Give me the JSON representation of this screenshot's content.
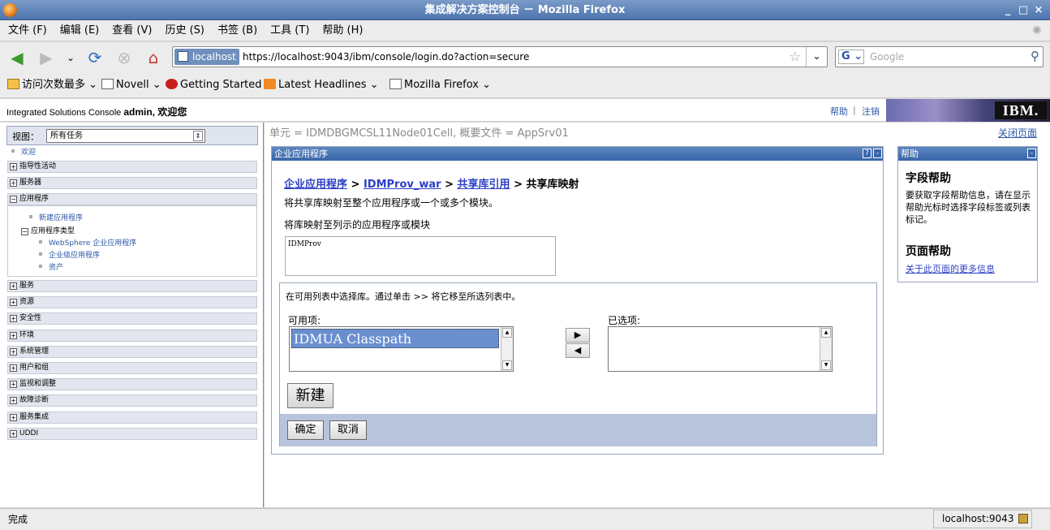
{
  "window": {
    "title": "集成解决方案控制台 － Mozilla Firefox",
    "controls": [
      "_",
      "□",
      "×"
    ]
  },
  "menu": [
    "文件 (F)",
    "编辑 (E)",
    "查看 (V)",
    "历史 (S)",
    "书签 (B)",
    "工具 (T)",
    "帮助 (H)"
  ],
  "nav": {
    "site_label": "localhost",
    "url": "https://localhost:9043/ibm/console/login.do?action=secure",
    "search_placeholder": "Google",
    "search_engine": "G"
  },
  "bookmarks": [
    {
      "label": "访问次数最多",
      "arrow": true,
      "icon": "most-visited-icon"
    },
    {
      "label": "Novell",
      "arrow": true,
      "icon": "folder-icon"
    },
    {
      "label": "Getting Started",
      "arrow": false,
      "icon": "firefox-red-icon"
    },
    {
      "label": "Latest Headlines",
      "arrow": true,
      "icon": "rss-icon"
    },
    {
      "label": "Mozilla Firefox",
      "arrow": true,
      "icon": "folder-icon"
    }
  ],
  "console": {
    "product": "Integrated Solutions Console",
    "user": "admin",
    "welcome": ", 欢迎您",
    "help": "帮助",
    "logout": "注销",
    "logo": "IBM."
  },
  "sidebar": {
    "view_label": "视图：",
    "view_value": "所有任务",
    "welcome": "欢迎",
    "items": [
      "指导性活动",
      "服务器",
      "应用程序",
      "服务",
      "资源",
      "安全性",
      "环境",
      "系统管理",
      "用户和组",
      "监视和调整",
      "故障诊断",
      "服务集成",
      "UDDI"
    ],
    "app_children": {
      "new_app": "新建应用程序",
      "app_types": "应用程序类型",
      "types": [
        "WebSphere 企业应用程序",
        "企业级应用程序",
        "资产"
      ]
    }
  },
  "main": {
    "cell_info": "单元 = IDMDBGMCSL11Node01Cell, 概要文件 = AppSrv01",
    "close_page": "关闭页面",
    "panel_title": "企业应用程序",
    "panel_buttons": [
      "?",
      "-"
    ],
    "breadcrumb": {
      "link1": "企业应用程序",
      "sep": " > ",
      "link2": "IDMProv_war",
      "link3": "共享库引用",
      "current": "共享库映射"
    },
    "description": "将共享库映射至整个应用程序或一个或多个模块。",
    "map_label": "将库映射至列示的应用程序或模块",
    "module": "IDMProv",
    "instruction": "在可用列表中选择库。通过单击 >> 将它移至所选列表中。",
    "available_label": "可用项:",
    "available_items": [
      "IDMUA Classpath"
    ],
    "selected_label": "已选项:",
    "move_right": "▶",
    "move_left": "◀",
    "new_button": "新建",
    "ok_button": "确定",
    "cancel_button": "取消"
  },
  "help": {
    "title": "帮助",
    "field_help_title": "字段帮助",
    "field_help_text": "要获取字段帮助信息，请在显示帮助光标时选择字段标签或列表标记。",
    "page_help_title": "页面帮助",
    "page_help_link": "关于此页面的更多信息"
  },
  "status": {
    "text": "完成",
    "host": "localhost:9043"
  }
}
